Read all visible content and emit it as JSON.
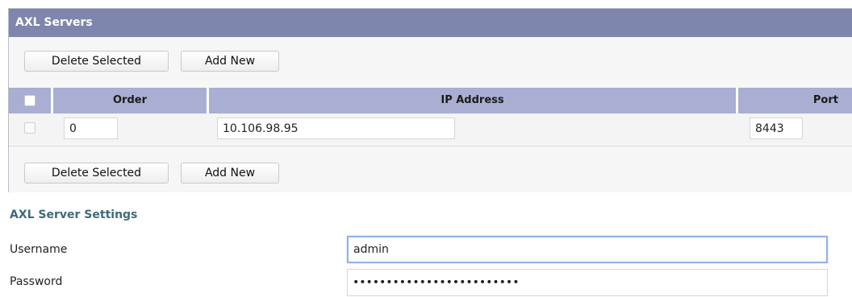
{
  "section": {
    "title": "AXL Servers"
  },
  "toolbar": {
    "delete_label": "Delete Selected",
    "add_label": "Add New"
  },
  "table": {
    "columns": [
      "Order",
      "IP Address",
      "Port"
    ],
    "rows": [
      {
        "order": "0",
        "ip_address": "10.106.98.95",
        "port": "8443"
      }
    ]
  },
  "settings": {
    "title": "AXL Server Settings",
    "username_label": "Username",
    "username_value": "admin",
    "password_label": "Password",
    "password_value": "•••••••••••••••••••••••••"
  }
}
